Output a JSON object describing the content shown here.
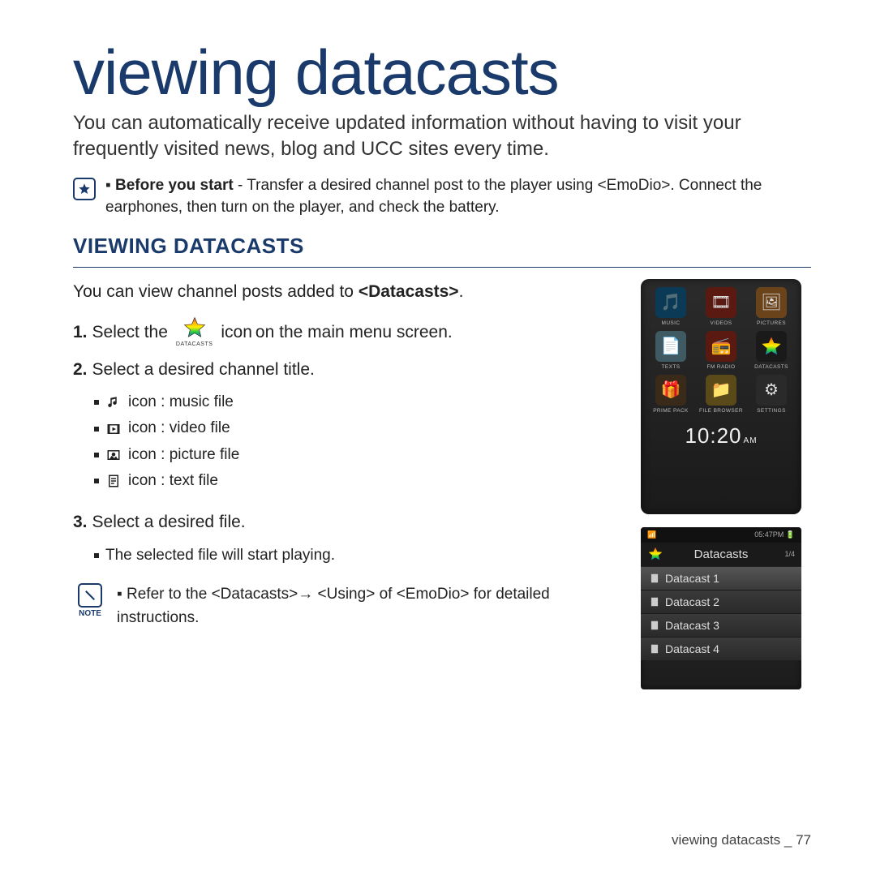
{
  "title": "viewing datacasts",
  "intro": "You can automatically receive updated information without having to visit your frequently visited news, blog and UCC sites every time.",
  "before": {
    "label": "Before you start",
    "text": " - Transfer a desired channel post to the player using <EmoDio>. Connect the earphones, then turn on the player, and check the battery."
  },
  "section_heading": "VIEWING DATACASTS",
  "line1_pre": "You can view channel posts added to ",
  "line1_bold": "<Datacasts>",
  "line1_post": ".",
  "steps": {
    "s1_pre": "Select the",
    "s1_icon_caption": "DATACASTS",
    "s1_post_bold": "icon",
    "s1_post": " on the main menu screen.",
    "s2": "Select a desired channel title.",
    "icon_list": [
      {
        "label": "icon : music file",
        "kind": "music"
      },
      {
        "label": "icon : video file",
        "kind": "video"
      },
      {
        "label": "icon : picture file",
        "kind": "picture"
      },
      {
        "label": "icon : text file",
        "kind": "text"
      }
    ],
    "s3": "Select a desired file.",
    "s3_sub": "The selected file will start playing."
  },
  "note": {
    "badge": "NOTE",
    "text": "Refer to the <Datacasts>→ <Using> of <EmoDio> for detailed instructions."
  },
  "footer": "viewing datacasts _ 77",
  "device_menu": {
    "items": [
      {
        "label": "MUSIC"
      },
      {
        "label": "VIDEOS"
      },
      {
        "label": "PICTURES"
      },
      {
        "label": "TEXTS"
      },
      {
        "label": "FM RADIO"
      },
      {
        "label": "DATACASTS"
      },
      {
        "label": "PRIME PACK"
      },
      {
        "label": "FILE BROWSER"
      },
      {
        "label": "SETTINGS"
      }
    ],
    "clock": "10:20",
    "ampm": "AM"
  },
  "device_list": {
    "status_time": "05:47PM",
    "title": "Datacasts",
    "count": "1/4",
    "items": [
      "Datacast 1",
      "Datacast 2",
      "Datacast 3",
      "Datacast 4"
    ]
  }
}
